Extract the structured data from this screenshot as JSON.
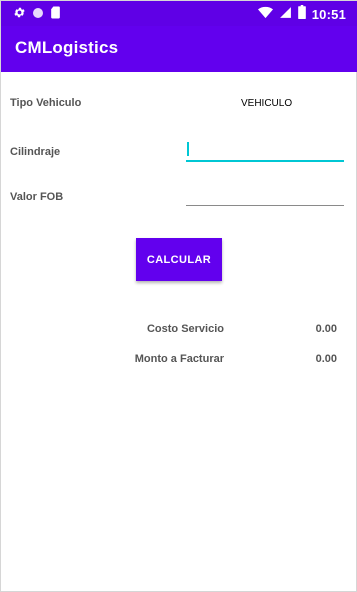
{
  "status_bar": {
    "time": "10:51",
    "left_icons": [
      "gear-icon",
      "circle-icon",
      "sim-card-icon"
    ],
    "right_icons": [
      "wifi-icon",
      "signal-icon",
      "battery-icon"
    ]
  },
  "app_bar": {
    "title": "CMLogistics"
  },
  "form": {
    "tipo_vehiculo_label": "Tipo Vehiculo",
    "tipo_vehiculo_value": "VEHICULO",
    "cilindraje_label": "Cilindraje",
    "cilindraje_value": "",
    "valor_fob_label": "Valor FOB",
    "valor_fob_value": ""
  },
  "actions": {
    "calcular_label": "CALCULAR"
  },
  "results": {
    "costo_servicio_label": "Costo Servicio",
    "costo_servicio_value": "0.00",
    "monto_facturar_label": "Monto a Facturar",
    "monto_facturar_value": "0.00"
  },
  "colors": {
    "primary": "#6200ee",
    "status_bar": "#5f00e6",
    "accent": "#00c7d4"
  }
}
